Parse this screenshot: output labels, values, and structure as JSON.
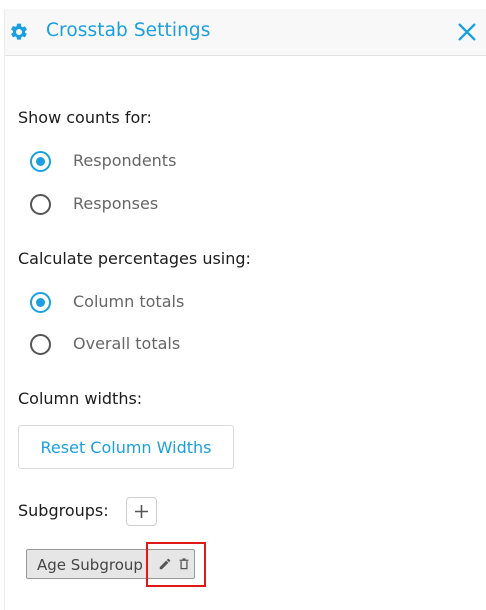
{
  "header": {
    "title": "Crosstab Settings",
    "icon": "gear-icon",
    "close_icon": "close-icon"
  },
  "counts": {
    "label": "Show counts for:",
    "options": [
      {
        "label": "Respondents",
        "checked": true
      },
      {
        "label": "Responses",
        "checked": false
      }
    ]
  },
  "percentages": {
    "label": "Calculate percentages using:",
    "options": [
      {
        "label": "Column totals",
        "checked": true
      },
      {
        "label": "Overall totals",
        "checked": false
      }
    ]
  },
  "column_widths": {
    "label": "Column widths:",
    "reset_label": "Reset Column Widths"
  },
  "subgroups": {
    "label": "Subgroups:",
    "add_icon": "plus-icon",
    "items": [
      {
        "label": "Age Subgroup",
        "edit_icon": "pencil-icon",
        "delete_icon": "trash-icon"
      }
    ]
  },
  "colors": {
    "accent": "#1a9fe0",
    "highlight": "#e01818"
  }
}
